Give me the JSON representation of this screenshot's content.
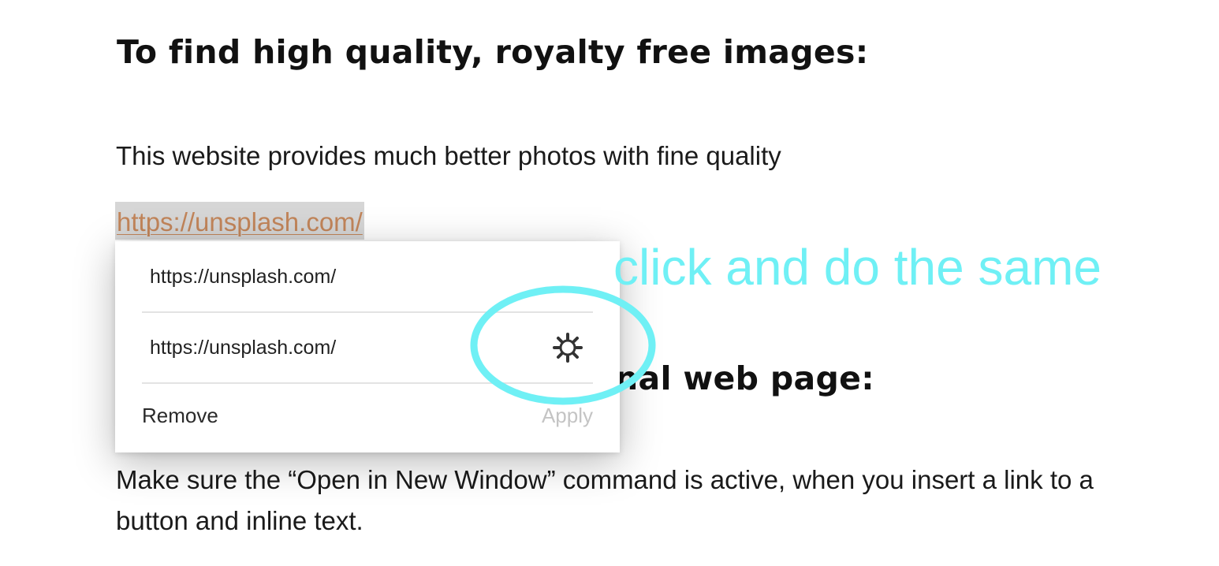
{
  "document": {
    "heading_1": "To find high quality, royalty free images:",
    "paragraph_1": "This website provides much better photos with fine quality",
    "selected_link": "https://unsplash.com/",
    "heading_2_visible": "nal web page:",
    "paragraph_2": "Make sure the “Open in New Window” command is active, when you insert a link to a button and inline text."
  },
  "link_popup": {
    "text_value": "https://unsplash.com/",
    "url_value": "https://unsplash.com/",
    "settings_icon": "gear-icon",
    "remove_label": "Remove",
    "apply_label": "Apply",
    "apply_enabled": false
  },
  "annotation": {
    "text": "click and do the same",
    "color": "#6ff0f5"
  },
  "colors": {
    "link": "#c2855a",
    "selection": "#d6d6d6",
    "highlight": "#6ff0f5"
  }
}
